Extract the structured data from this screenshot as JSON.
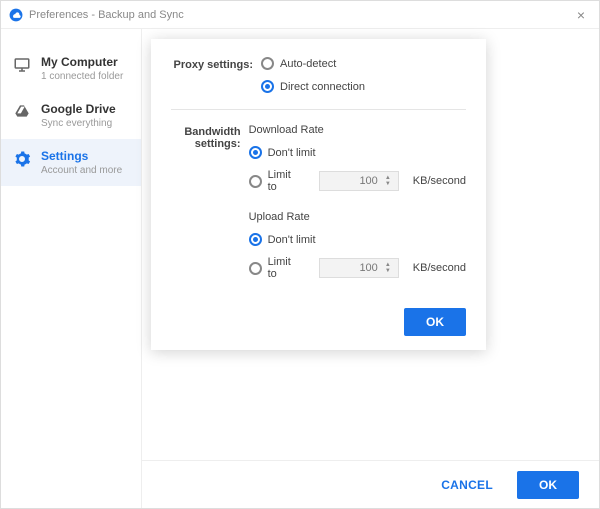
{
  "window": {
    "title": "Preferences - Backup and Sync"
  },
  "sidebar": {
    "items": [
      {
        "title": "My Computer",
        "subtitle": "1 connected folder"
      },
      {
        "title": "Google Drive",
        "subtitle": "Sync everything"
      },
      {
        "title": "Settings",
        "subtitle": "Account and more"
      }
    ]
  },
  "modal": {
    "proxy": {
      "label": "Proxy settings:",
      "auto": "Auto-detect",
      "direct": "Direct connection",
      "selected": "direct"
    },
    "bandwidth": {
      "label": "Bandwidth settings:",
      "download": {
        "heading": "Download Rate",
        "dont": "Don't limit",
        "limit": "Limit to",
        "value": "100",
        "unit": "KB/second",
        "selected": "dont"
      },
      "upload": {
        "heading": "Upload Rate",
        "dont": "Don't limit",
        "limit": "Limit to",
        "value": "100",
        "unit": "KB/second",
        "selected": "dont"
      }
    },
    "ok": "OK"
  },
  "footer": {
    "cancel": "CANCEL",
    "ok": "OK"
  }
}
